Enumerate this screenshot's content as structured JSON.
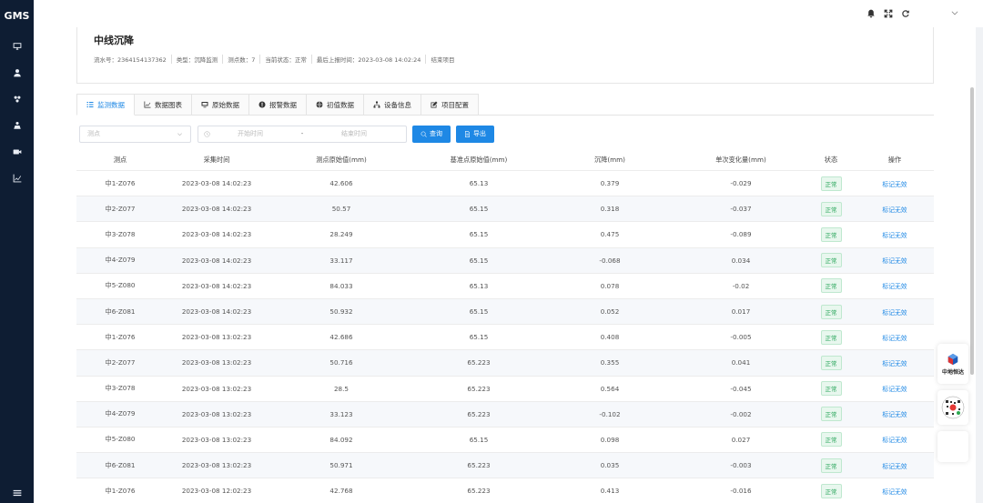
{
  "app": {
    "brand": "GMS"
  },
  "sidebar": {
    "icons": [
      "monitor-icon",
      "user-icon",
      "org-icon",
      "team-icon",
      "video-icon",
      "chart-icon"
    ],
    "bottom_icon": "menu-icon"
  },
  "topbar": {
    "icons": [
      "bell-icon",
      "fullscreen-icon",
      "refresh-icon"
    ],
    "dropdown": "chevron-down-icon"
  },
  "project": {
    "title": "中线沉降",
    "meta": [
      "流水号：2364154137362",
      "类型：沉降监测",
      "测点数：7",
      "当前状态：正常",
      "最后上报时间：2023-03-08 14:02:24",
      "结束项目"
    ]
  },
  "tabs": [
    {
      "label": "监测数据",
      "icon": "list-icon",
      "active": true
    },
    {
      "label": "数据图表",
      "icon": "chart-icon"
    },
    {
      "label": "原始数据",
      "icon": "monitor-icon"
    },
    {
      "label": "报警数据",
      "icon": "alert-icon"
    },
    {
      "label": "初值数据",
      "icon": "globe-icon"
    },
    {
      "label": "设备信息",
      "icon": "sitemap-icon"
    },
    {
      "label": "项目配置",
      "icon": "edit-icon"
    }
  ],
  "filters": {
    "point_placeholder": "测点",
    "start_placeholder": "开始时间",
    "separator": "-",
    "end_placeholder": "结束时间",
    "query_label": "查询",
    "export_label": "导出"
  },
  "table": {
    "headers": [
      "测点",
      "采集时间",
      "测点原始值(mm)",
      "基准点原始值(mm)",
      "沉降(mm)",
      "单次变化量(mm)",
      "状态",
      "操作"
    ],
    "rows": [
      [
        "中1-Z076",
        "2023-03-08 14:02:23",
        "42.606",
        "65.13",
        "0.379",
        "-0.029",
        "正常",
        "标记无效"
      ],
      [
        "中2-Z077",
        "2023-03-08 14:02:23",
        "50.57",
        "65.15",
        "0.318",
        "-0.037",
        "正常",
        "标记无效"
      ],
      [
        "中3-Z078",
        "2023-03-08 14:02:23",
        "28.249",
        "65.15",
        "0.475",
        "-0.089",
        "正常",
        "标记无效"
      ],
      [
        "中4-Z079",
        "2023-03-08 14:02:23",
        "33.117",
        "65.15",
        "-0.068",
        "0.034",
        "正常",
        "标记无效"
      ],
      [
        "中5-Z080",
        "2023-03-08 14:02:23",
        "84.033",
        "65.13",
        "0.078",
        "-0.02",
        "正常",
        "标记无效"
      ],
      [
        "中6-Z081",
        "2023-03-08 14:02:23",
        "50.932",
        "65.15",
        "0.052",
        "0.017",
        "正常",
        "标记无效"
      ],
      [
        "中1-Z076",
        "2023-03-08 13:02:23",
        "42.686",
        "65.15",
        "0.408",
        "-0.005",
        "正常",
        "标记无效"
      ],
      [
        "中2-Z077",
        "2023-03-08 13:02:23",
        "50.716",
        "65.223",
        "0.355",
        "0.041",
        "正常",
        "标记无效"
      ],
      [
        "中3-Z078",
        "2023-03-08 13:02:23",
        "28.5",
        "65.223",
        "0.564",
        "-0.045",
        "正常",
        "标记无效"
      ],
      [
        "中4-Z079",
        "2023-03-08 13:02:23",
        "33.123",
        "65.223",
        "-0.102",
        "-0.002",
        "正常",
        "标记无效"
      ],
      [
        "中5-Z080",
        "2023-03-08 13:02:23",
        "84.092",
        "65.15",
        "0.098",
        "0.027",
        "正常",
        "标记无效"
      ],
      [
        "中6-Z081",
        "2023-03-08 13:02:23",
        "50.971",
        "65.223",
        "0.035",
        "-0.003",
        "正常",
        "标记无效"
      ],
      [
        "中1-Z076",
        "2023-03-08 12:02:23",
        "42.768",
        "65.223",
        "0.413",
        "-0.016",
        "正常",
        "标记无效"
      ]
    ]
  },
  "float_widgets": {
    "logo_label": "中地恒达"
  }
}
